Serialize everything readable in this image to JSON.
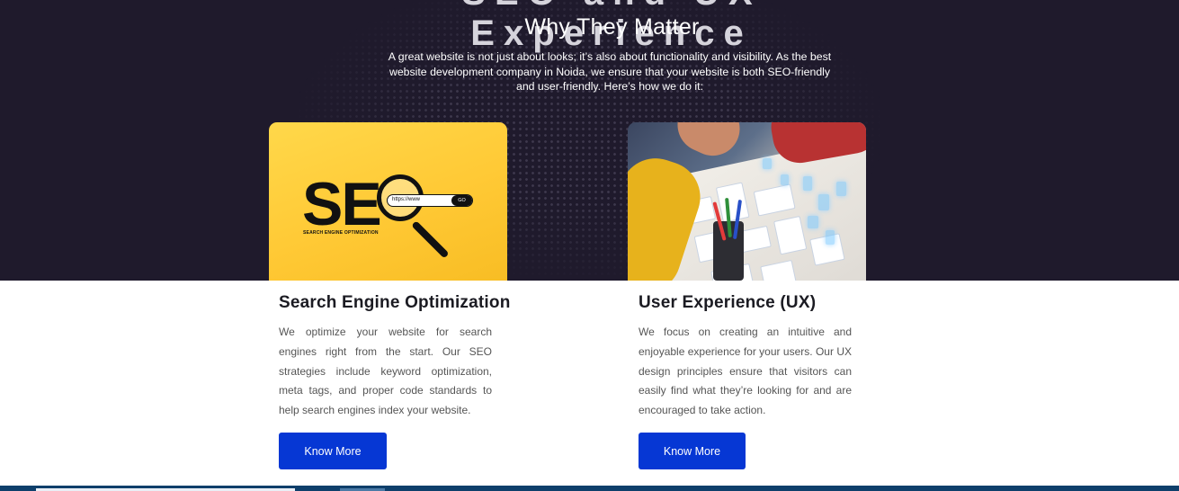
{
  "hero": {
    "cut_title": "SEO and UX Experience",
    "title": "Why They Matter",
    "description": "A great website is not just about looks; it’s also about functionality and visibility. As the best website development company in Noida, we ensure that your website is both SEO-friendly and user-friendly. Here’s how we do it:"
  },
  "cards": [
    {
      "image": {
        "big_text": "SE",
        "subtitle": "SEARCH ENGINE OPTIMIZATION",
        "search_text": "https://www",
        "go_label": "GO"
      },
      "title": "Search Engine Optimization",
      "body": "We optimize your website for search engines right from the start. Our SEO strategies include keyword optimization, meta tags, and proper code standards to help search engines index your website.",
      "button_label": "Know More"
    },
    {
      "title": "User Experience (UX)",
      "body": "We focus on creating an intuitive and enjoyable experience for your users. Our UX design principles ensure that visitors can easily find what they’re looking for and are encouraged to take action.",
      "button_label": "Know More"
    }
  ],
  "colors": {
    "hero_background": "#1f1a2c",
    "button": "#0637d4",
    "seo_yellow": "#ffc935",
    "footer_strip": "#0e3f6b"
  }
}
